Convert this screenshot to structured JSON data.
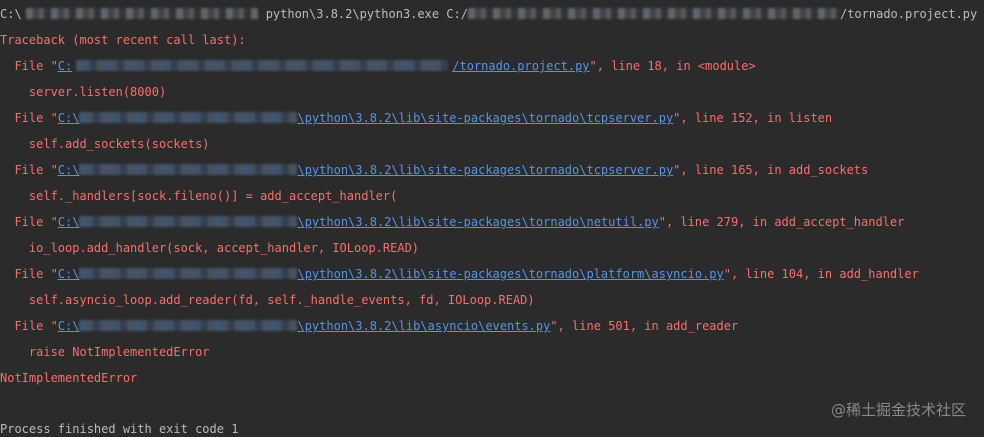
{
  "console": {
    "command": {
      "prefix": "C:\\",
      "exe": "python\\3.8.2\\python3.exe C:/",
      "script": "/tornado.project.py"
    },
    "traceback_header": "Traceback (most recent call last):",
    "frames": [
      {
        "file_prefix": "  File \"",
        "link_start": "C:",
        "link_end": "/tornado.project.py",
        "location": "\", line 18, in <module>",
        "code": "    server.listen(8000)"
      },
      {
        "file_prefix": "  File \"",
        "link_start": "C:\\",
        "link_end": "\\python\\3.8.2\\lib\\site-packages\\tornado\\tcpserver.py",
        "location": "\", line 152, in listen",
        "code": "    self.add_sockets(sockets)"
      },
      {
        "file_prefix": "  File \"",
        "link_start": "C:\\",
        "link_end": "\\python\\3.8.2\\lib\\site-packages\\tornado\\tcpserver.py",
        "location": "\", line 165, in add_sockets",
        "code": "    self._handlers[sock.fileno()] = add_accept_handler("
      },
      {
        "file_prefix": "  File \"",
        "link_start": "C:\\",
        "link_end": "\\python\\3.8.2\\lib\\site-packages\\tornado\\netutil.py",
        "location": "\", line 279, in add_accept_handler",
        "code": "    io_loop.add_handler(sock, accept_handler, IOLoop.READ)"
      },
      {
        "file_prefix": "  File \"",
        "link_start": "C:\\",
        "link_end": "\\python\\3.8.2\\lib\\site-packages\\tornado\\platform\\asyncio.py",
        "location": "\", line 104, in add_handler",
        "code": "    self.asyncio_loop.add_reader(fd, self._handle_events, fd, IOLoop.READ)"
      },
      {
        "file_prefix": "  File \"",
        "link_start": "C:\\",
        "link_end": "\\python\\3.8.2\\lib\\asyncio\\events.py",
        "location": "\", line 501, in add_reader",
        "code": "    raise NotImplementedError"
      }
    ],
    "exception": "NotImplementedError",
    "exit_message": "Process finished with exit code 1"
  },
  "watermark": {
    "text": "稀土掘金技术社区",
    "at_sign": "@"
  },
  "colors": {
    "background": "#2b2b2b",
    "error_text": "#ff6b68",
    "link": "#5394ec",
    "plain_text": "#bbbbbb"
  }
}
